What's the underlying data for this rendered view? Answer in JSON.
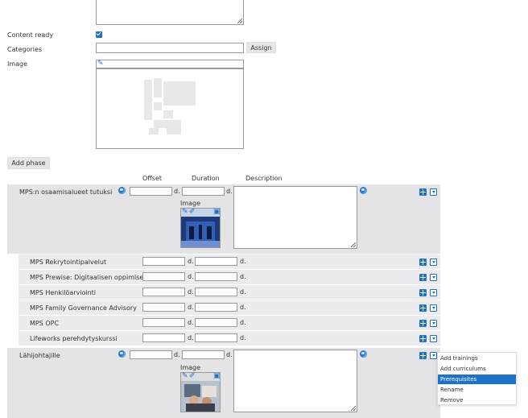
{
  "form": {
    "content_ready_label": "Content ready",
    "content_ready_checked": true,
    "categories_label": "Categories",
    "categories_value": "",
    "assign_label": "Assign",
    "image_label": "Image"
  },
  "add_phase_label": "Add phase",
  "columns": {
    "offset": "Offset",
    "duration": "Duration",
    "description": "Description"
  },
  "unit": "d.",
  "phases": [
    {
      "name": "MPS:n osaamisalueet tutuksi",
      "image_label": "Image",
      "items": [
        "MPS Rekrytointipalvelut",
        "MPS Prewise: Digitaalisen oppimise...",
        "MPS Henkilöarviointi",
        "MPS Family Governance Advisory",
        "MPS OPC",
        "Lifeworks perehdytyskurssi"
      ]
    },
    {
      "name": "Lähijohtajille",
      "image_label": "Image",
      "items": []
    }
  ],
  "context_menu": {
    "items": [
      "Add trainings",
      "Add curriculums",
      "Prerequisites",
      "Rename",
      "Remove"
    ],
    "selected": "Prerequisites"
  },
  "colors": {
    "accent": "#1e73c8",
    "row_bg": "#e4e4e6"
  },
  "icons": {
    "globe": "globe-icon",
    "move": "move-icon",
    "dropdown": "dropdown-icon",
    "edit": "edit-icon"
  }
}
